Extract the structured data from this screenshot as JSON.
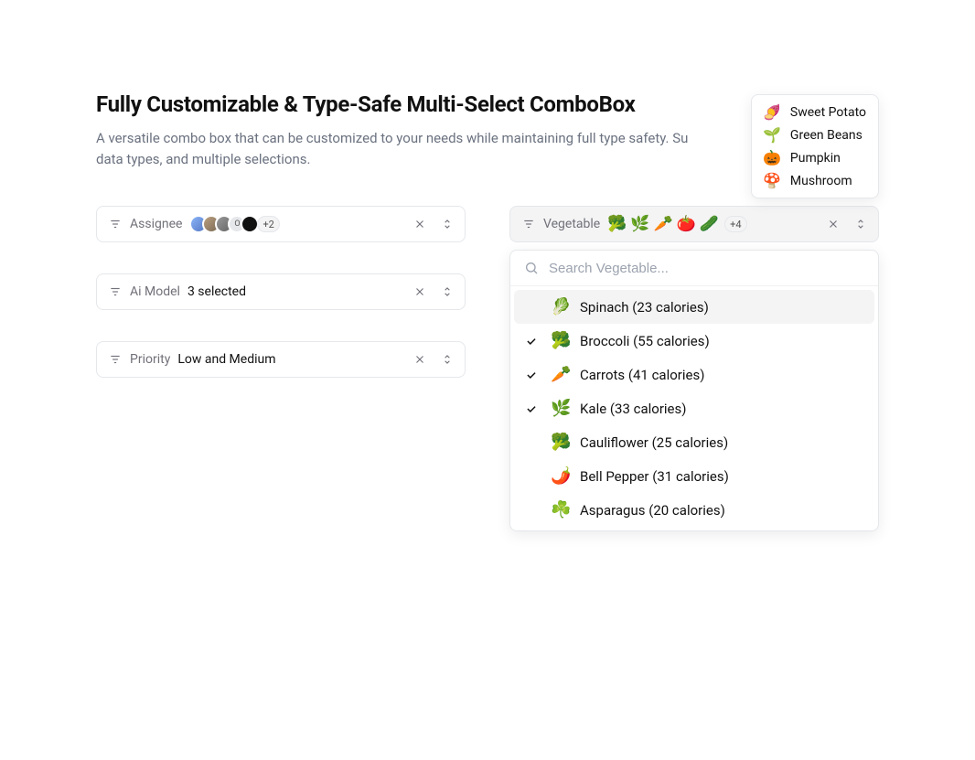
{
  "title": "Fully Customizable & Type-Safe Multi-Select ComboBox",
  "subtitle_pre": "A versatile combo box that can be customized to your needs while maintaining full type safety. Su",
  "subtitle_post": "ndering, generic data types, and multiple selections.",
  "combos": {
    "assignee": {
      "label": "Assignee",
      "more": "+2",
      "initial": "O"
    },
    "aiModel": {
      "label": "Ai Model",
      "value": "3 selected"
    },
    "priority": {
      "label": "Priority",
      "value": "Low and Medium"
    },
    "vegetable": {
      "label": "Vegetable",
      "selectedIcons": [
        "🥦",
        "🌿",
        "🥕",
        "🍅",
        "🥒"
      ],
      "more": "+4"
    }
  },
  "overflow": [
    {
      "icon": "🍠",
      "name": "Sweet Potato"
    },
    {
      "icon": "🌱",
      "name": "Green Beans"
    },
    {
      "icon": "🎃",
      "name": "Pumpkin"
    },
    {
      "icon": "🍄",
      "name": "Mushroom"
    }
  ],
  "search": {
    "placeholder": "Search Vegetable..."
  },
  "options": [
    {
      "icon": "🥬",
      "label": "Spinach (23 calories)",
      "checked": false,
      "highlight": true
    },
    {
      "icon": "🥦",
      "label": "Broccoli (55 calories)",
      "checked": true,
      "highlight": false
    },
    {
      "icon": "🥕",
      "label": "Carrots (41 calories)",
      "checked": true,
      "highlight": false
    },
    {
      "icon": "🌿",
      "label": "Kale (33 calories)",
      "checked": true,
      "highlight": false
    },
    {
      "icon": "🥦",
      "label": "Cauliflower (25 calories)",
      "checked": false,
      "highlight": false
    },
    {
      "icon": "🌶️",
      "label": "Bell Pepper (31 calories)",
      "checked": false,
      "highlight": false
    },
    {
      "icon": "☘️",
      "label": "Asparagus (20 calories)",
      "checked": false,
      "highlight": false
    }
  ]
}
